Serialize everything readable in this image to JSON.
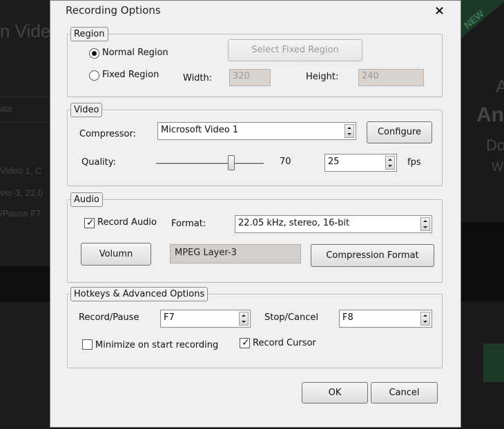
{
  "background": {
    "texts": [
      "n Vide",
      "ate",
      "Video 1, C",
      "ver-3, 22.0",
      "/Pause F7",
      "A",
      "An",
      "Do",
      "W",
      "NEW"
    ]
  },
  "dialog": {
    "title": "Recording Options",
    "close_glyph": "×"
  },
  "region": {
    "legend": "Region",
    "normal_label": "Normal Region",
    "fixed_label": "Fixed Region",
    "selected": "normal",
    "select_fixed_label": "Select Fixed Region",
    "width_label": "Width:",
    "width_value": "320",
    "height_label": "Height:",
    "height_value": "240"
  },
  "video": {
    "legend": "Video",
    "compressor_label": "Compressor:",
    "compressor_value": "Microsoft Video 1",
    "configure_label": "Configure",
    "quality_label": "Quality:",
    "quality_value": "70",
    "quality_fraction": 0.7,
    "fps_value": "25",
    "fps_label": "fps"
  },
  "audio": {
    "legend": "Audio",
    "record_audio_label": "Record Audio",
    "record_audio_checked": true,
    "format_label": "Format:",
    "format_value": "22.05 kHz, stereo, 16-bit",
    "volumn_label": "Volumn",
    "codec_value": "MPEG Layer-3",
    "compression_format_label": "Compression Format"
  },
  "hotkeys": {
    "legend": "Hotkeys & Advanced Options",
    "record_pause_label": "Record/Pause",
    "record_pause_value": "F7",
    "stop_cancel_label": "Stop/Cancel",
    "stop_cancel_value": "F8",
    "minimize_label": "Minimize on start recording",
    "minimize_checked": false,
    "record_cursor_label": "Record Cursor",
    "record_cursor_checked": true
  },
  "footer": {
    "ok_label": "OK",
    "cancel_label": "Cancel"
  }
}
